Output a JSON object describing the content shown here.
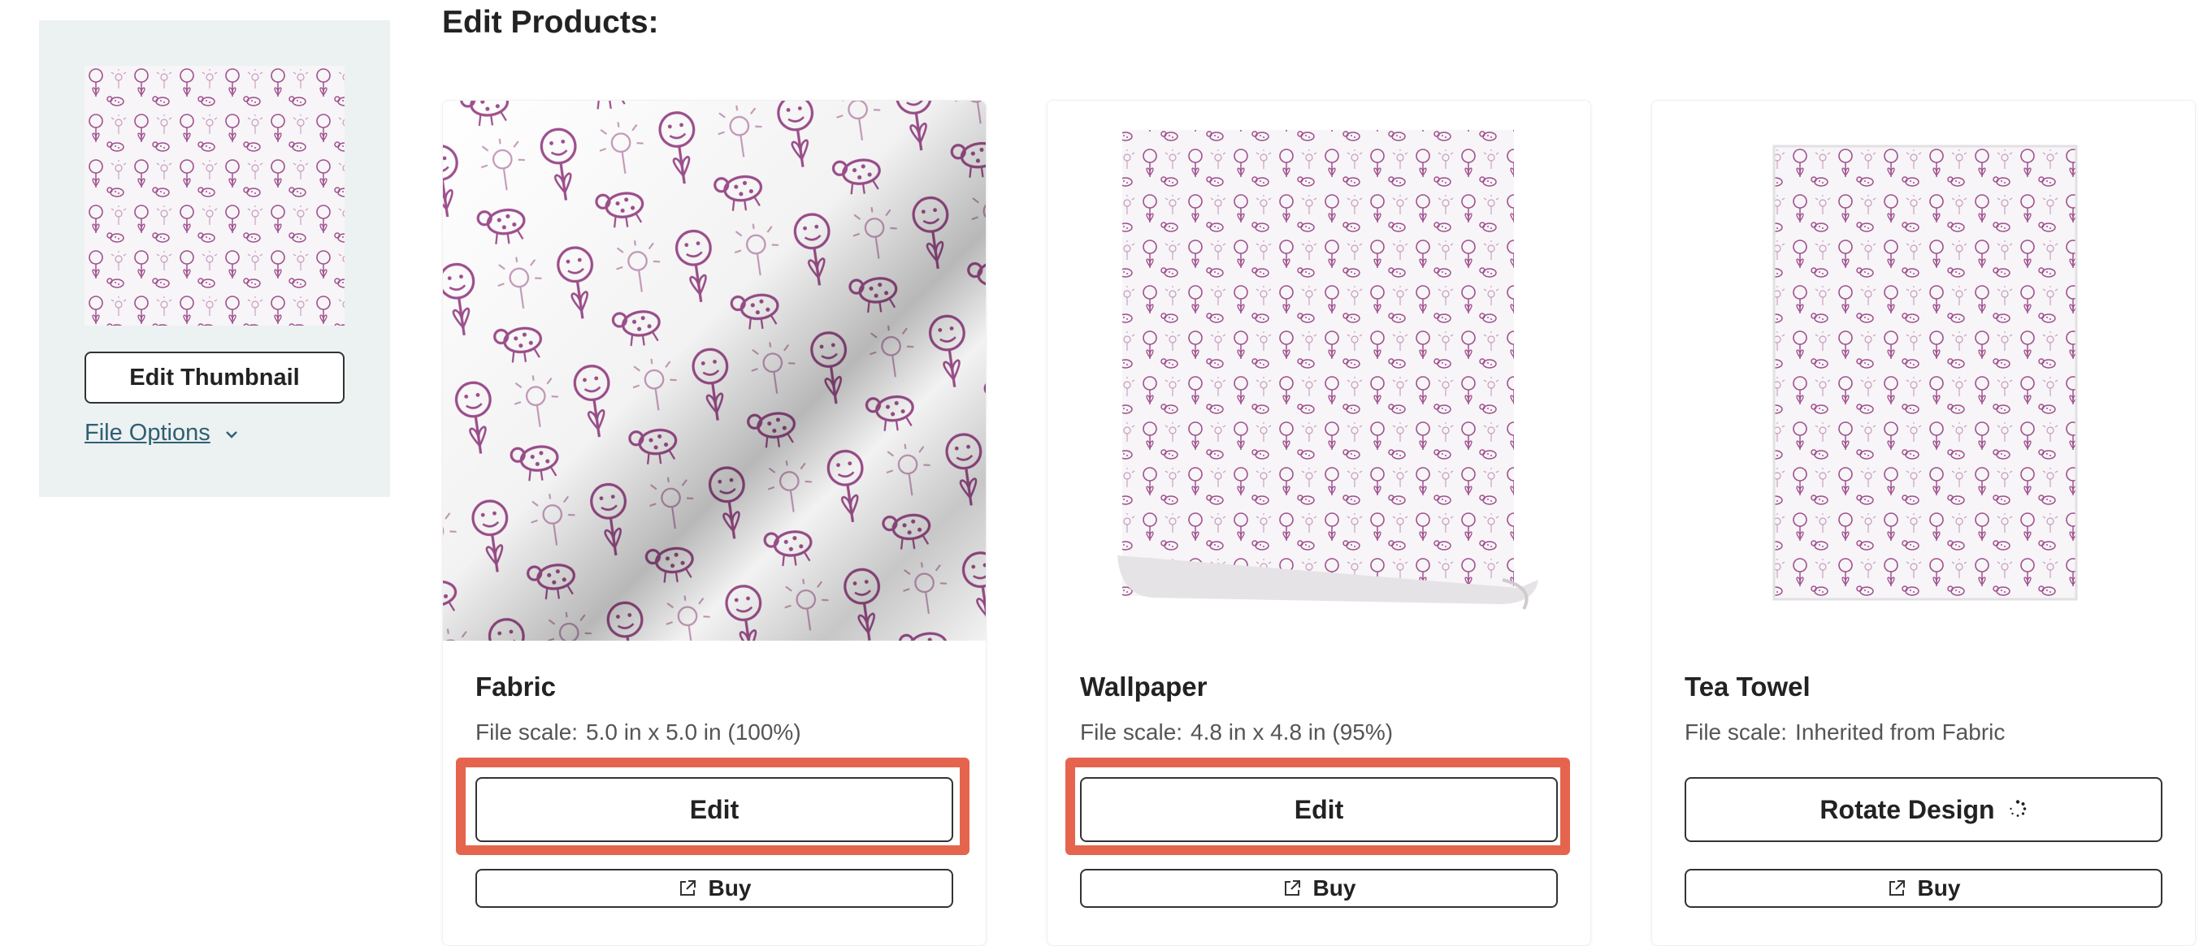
{
  "sidebar": {
    "edit_thumbnail_label": "Edit Thumbnail",
    "file_options_label": "File Options"
  },
  "page": {
    "title": "Edit Products:"
  },
  "products": [
    {
      "name": "Fabric",
      "scale_label": "File scale:",
      "scale_value": "5.0 in x 5.0 in (100%)",
      "primary_button": "Edit",
      "buy_label": "Buy",
      "highlighted": true
    },
    {
      "name": "Wallpaper",
      "scale_label": "File scale:",
      "scale_value": "4.8 in x 4.8 in (95%)",
      "primary_button": "Edit",
      "buy_label": "Buy",
      "highlighted": true
    },
    {
      "name": "Tea Towel",
      "scale_label": "File scale:",
      "scale_value": "Inherited from Fabric",
      "primary_button": "Rotate Design",
      "buy_label": "Buy",
      "highlighted": false
    }
  ],
  "colors": {
    "sidebar_bg": "#ecf1f1",
    "link": "#2f5f73",
    "highlight": "#e5644e",
    "pattern": "#a0508f"
  },
  "icons": {
    "file_options_chevron": "chevron-down-icon",
    "buy": "external-link-icon",
    "rotate": "loading-spinner-icon"
  }
}
